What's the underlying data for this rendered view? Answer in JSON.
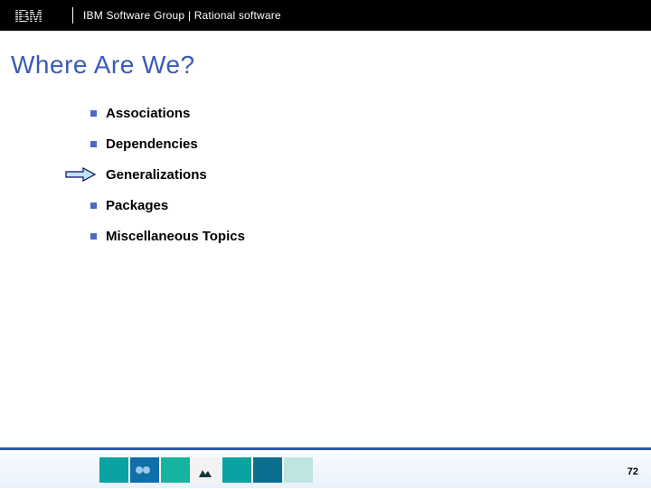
{
  "header": {
    "brand": "IBM",
    "text": "IBM Software Group | Rational software"
  },
  "title": "Where Are We?",
  "items": [
    {
      "label": "Associations",
      "current": false
    },
    {
      "label": "Dependencies",
      "current": false
    },
    {
      "label": "Generalizations",
      "current": true
    },
    {
      "label": "Packages",
      "current": false
    },
    {
      "label": "Miscellaneous Topics",
      "current": false
    }
  ],
  "page_number": "72"
}
